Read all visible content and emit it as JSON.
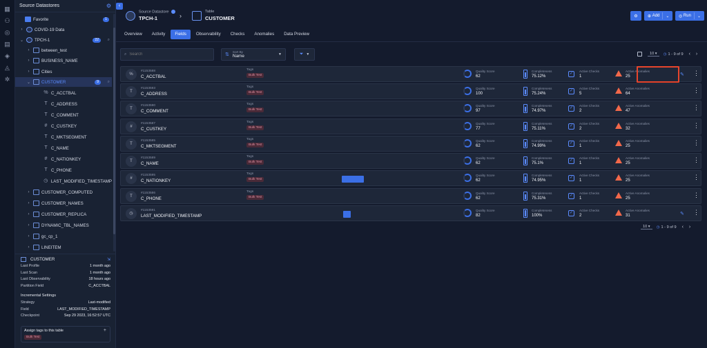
{
  "sidebar": {
    "title": "Source Datastores",
    "collapse_icon": "chevron-left-icon",
    "tree": [
      {
        "label": "Favorite",
        "level": 0,
        "icon": "star",
        "count": "1",
        "chevron": ""
      },
      {
        "label": "COVID-19 Data",
        "level": 1,
        "icon": "db",
        "chevron": "›"
      },
      {
        "label": "TPCH-1",
        "level": 1,
        "icon": "db",
        "chevron": "⌄",
        "count": "22",
        "search": true
      },
      {
        "label": "between_test",
        "level": 2,
        "icon": "table",
        "chevron": "›"
      },
      {
        "label": "BUSINESS_NAME",
        "level": 2,
        "icon": "table",
        "chevron": "›"
      },
      {
        "label": "Cities",
        "level": 2,
        "icon": "table",
        "chevron": "›"
      },
      {
        "label": "CUSTOMER",
        "level": 2,
        "icon": "table",
        "chevron": "⌄",
        "count": "9",
        "search": true,
        "selected": true
      },
      {
        "label": "C_ACCTBAL",
        "level": 3,
        "icon": "%"
      },
      {
        "label": "C_ADDRESS",
        "level": 3,
        "icon": "T"
      },
      {
        "label": "C_COMMENT",
        "level": 3,
        "icon": "T"
      },
      {
        "label": "C_CUSTKEY",
        "level": 3,
        "icon": "123"
      },
      {
        "label": "C_MKTSEGMENT",
        "level": 3,
        "icon": "T"
      },
      {
        "label": "C_NAME",
        "level": 3,
        "icon": "T"
      },
      {
        "label": "C_NATIONKEY",
        "level": 3,
        "icon": "123"
      },
      {
        "label": "C_PHONE",
        "level": 3,
        "icon": "T"
      },
      {
        "label": "LAST_MODIFIED_TIMESTAMP",
        "level": 3,
        "icon": "clock"
      },
      {
        "label": "CUSTOMER_COMPUTED",
        "level": 2,
        "icon": "table",
        "chevron": "›"
      },
      {
        "label": "CUSTOMER_NAMES",
        "level": 2,
        "icon": "table",
        "chevron": "›"
      },
      {
        "label": "CUSTOMER_REPLICA",
        "level": 2,
        "icon": "table",
        "chevron": "›"
      },
      {
        "label": "DYNAMIC_TBL_NAMES",
        "level": 2,
        "icon": "table",
        "chevron": "›"
      },
      {
        "label": "gc_cp_1",
        "level": 2,
        "icon": "table",
        "chevron": "›"
      },
      {
        "label": "LINEITEM",
        "level": 2,
        "icon": "table",
        "chevron": "›"
      }
    ],
    "info": {
      "title": "CUSTOMER",
      "rows": [
        {
          "k": "Last Profile",
          "v": "1 month ago"
        },
        {
          "k": "Last Scan",
          "v": "1 month ago"
        },
        {
          "k": "Last Observability",
          "v": "18 hours ago"
        },
        {
          "k": "Partition Field",
          "v": "C_ACCTBAL"
        }
      ],
      "incremental_title": "Incremental Settings",
      "incremental": [
        {
          "k": "Strategy",
          "v": "Last-modified"
        },
        {
          "k": "Field",
          "v": "LAST_MODIFIED_TIMESTAMP"
        },
        {
          "k": "Checkpoint",
          "v": "Sep 29 2023, 16:52:57 UTC"
        }
      ],
      "assign_tags": "Assign tags to this table",
      "tag": "Bulk Test"
    }
  },
  "header": {
    "source_label": "Source Datastore",
    "source_name": "TPCH-1",
    "table_label": "Table",
    "table_name": "CUSTOMER",
    "add_label": "Add",
    "run_label": "Run",
    "settings_icon": "gear-icon"
  },
  "tabs": [
    {
      "label": "Overview",
      "active": false
    },
    {
      "label": "Activity",
      "active": false
    },
    {
      "label": "Fields",
      "active": true
    },
    {
      "label": "Observability",
      "active": false
    },
    {
      "label": "Checks",
      "active": false
    },
    {
      "label": "Anomalies",
      "active": false
    },
    {
      "label": "Data Preview",
      "active": false
    }
  ],
  "filters": {
    "search_placeholder": "Search",
    "sort_caption": "Sort By",
    "sort_value": "Name"
  },
  "pagination": {
    "page_size": "10",
    "range": "1 - 9 of 9"
  },
  "labels": {
    "tags": "Tags",
    "quality_score": "Quality Score",
    "completeness": "Completeness",
    "active_checks": "Active Checks",
    "active_anomalies": "Active Anomalies"
  },
  "fields": [
    {
      "id": "#1153588",
      "name": "C_ACCTBAL",
      "type_icon": "%",
      "tag": "Bulk Test",
      "quality": "62",
      "completeness": "75.12%",
      "completeness_frac": 0.7512,
      "checks": "1",
      "anomalies": "25",
      "extra_icon": true
    },
    {
      "id": "#1153593",
      "name": "C_ADDRESS",
      "type_icon": "T",
      "tag": "Bulk Test",
      "quality": "100",
      "completeness": "75.24%",
      "completeness_frac": 0.7524,
      "checks": "5",
      "anomalies": "64"
    },
    {
      "id": "#1153590",
      "name": "C_COMMENT",
      "type_icon": "T",
      "tag": "Bulk Test",
      "quality": "97",
      "completeness": "74.97%",
      "completeness_frac": 0.7497,
      "checks": "2",
      "anomalies": "47"
    },
    {
      "id": "#1153587",
      "name": "C_CUSTKEY",
      "type_icon": "123",
      "tag": "Bulk Test",
      "quality": "77",
      "completeness": "75.11%",
      "completeness_frac": 0.7511,
      "checks": "2",
      "anomalies": "32"
    },
    {
      "id": "#1153585",
      "name": "C_MKTSEGMENT",
      "type_icon": "T",
      "tag": "Bulk Test",
      "quality": "62",
      "completeness": "74.99%",
      "completeness_frac": 0.7499,
      "checks": "1",
      "anomalies": "25"
    },
    {
      "id": "#1153589",
      "name": "C_NAME",
      "type_icon": "T",
      "tag": "Bulk Test",
      "quality": "62",
      "completeness": "75.1%",
      "completeness_frac": 0.751,
      "checks": "1",
      "anomalies": "25"
    },
    {
      "id": "#1153595",
      "name": "C_NATIONKEY",
      "type_icon": "123",
      "tag": "Bulk Test",
      "quality": "62",
      "completeness": "74.95%",
      "completeness_frac": 0.7495,
      "checks": "1",
      "anomalies": "25",
      "spark": "wide"
    },
    {
      "id": "#1153586",
      "name": "C_PHONE",
      "type_icon": "T",
      "tag": "Bulk Test",
      "quality": "62",
      "completeness": "75.31%",
      "completeness_frac": 0.7531,
      "checks": "1",
      "anomalies": "25"
    },
    {
      "id": "#1153591",
      "name": "LAST_MODIFIED_TIMESTAMP",
      "type_icon": "clock",
      "tag": "",
      "quality": "82",
      "completeness": "100%",
      "completeness_frac": 1.0,
      "checks": "2",
      "anomalies": "31",
      "spark": "small",
      "extra_icon": true
    }
  ]
}
